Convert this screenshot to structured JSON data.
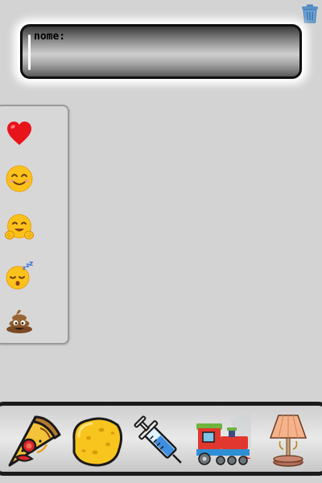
{
  "name_field": {
    "label": "nome:",
    "value": ""
  },
  "icons": {
    "trash": "trash-icon",
    "emojis": [
      "heart-emoji-icon",
      "smiling-face-emoji-icon",
      "hugging-face-emoji-icon",
      "sleeping-face-emoji-icon",
      "poop-emoji-icon"
    ],
    "items": [
      "pizza-icon",
      "sponge-icon",
      "syringe-icon",
      "train-icon",
      "lamp-icon"
    ]
  },
  "colors": {
    "background": "#d3d3d3",
    "trash": "#5a8fc4",
    "tray_border": "#1b1b1b"
  }
}
